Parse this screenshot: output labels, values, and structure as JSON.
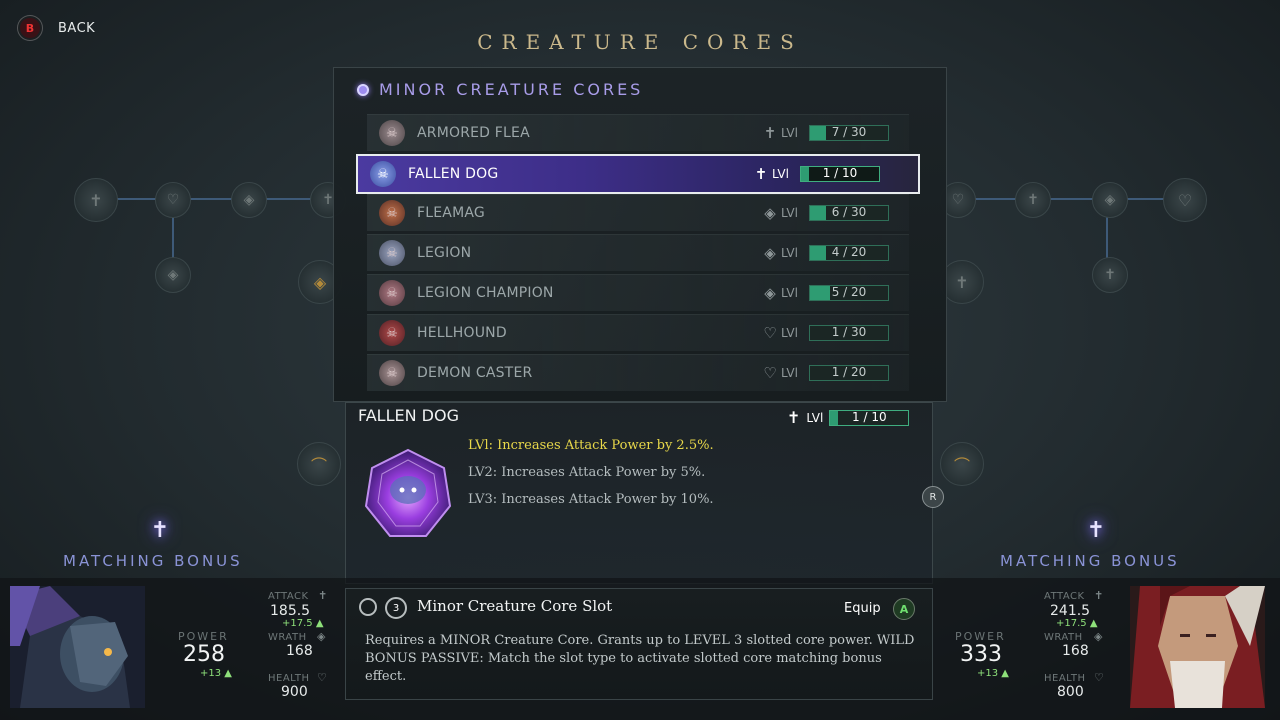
{
  "header": {
    "back_button_glyph": "B",
    "back_label": "BACK",
    "title": "CREATURE CORES"
  },
  "category": {
    "label": "MINOR CREATURE CORES"
  },
  "cores": [
    {
      "name": "ARMORED FLEA",
      "type_icon": "attack-icon",
      "lv_label": "LVl",
      "progress": "7 / 30",
      "fill": 0.2,
      "selected": false
    },
    {
      "name": "FALLEN DOG",
      "type_icon": "attack-icon",
      "lv_label": "LVl",
      "progress": "1 / 10",
      "fill": 0.1,
      "selected": true
    },
    {
      "name": "FLEAMAG",
      "type_icon": "wrath-icon",
      "lv_label": "LVl",
      "progress": "6 / 30",
      "fill": 0.2,
      "selected": false
    },
    {
      "name": "LEGION",
      "type_icon": "wrath-icon",
      "lv_label": "LVl",
      "progress": "4 / 20",
      "fill": 0.2,
      "selected": false
    },
    {
      "name": "LEGION CHAMPION",
      "type_icon": "wrath-icon",
      "lv_label": "LVl",
      "progress": "5 / 20",
      "fill": 0.25,
      "selected": false
    },
    {
      "name": "HELLHOUND",
      "type_icon": "health-icon",
      "lv_label": "LVl",
      "progress": "1 / 30",
      "fill": 0.0,
      "selected": false
    },
    {
      "name": "DEMON CASTER",
      "type_icon": "health-icon",
      "lv_label": "LVl",
      "progress": "1 / 20",
      "fill": 0.0,
      "selected": false
    }
  ],
  "detail": {
    "name": "FALLEN DOG",
    "lv_label": "LVl",
    "progress": "1 / 10",
    "fill": 0.1,
    "levels": [
      "LVl:  Increases Attack Power by 2.5%.",
      "LV2:  Increases Attack Power by 5%.",
      "LV3:  Increases Attack Power by 10%."
    ],
    "r_button": "R"
  },
  "slot": {
    "number": "3",
    "title": "Minor Creature Core Slot",
    "equip_label": "Equip",
    "equip_button": "A",
    "description": "Requires a MINOR Creature Core. Grants up to LEVEL 3 slotted core power. WILD BONUS PASSIVE: Match the slot type to activate slotted core matching bonus effect."
  },
  "left_character": {
    "matching_bonus": "MATCHING BONUS",
    "power_label": "POWER",
    "power": "258",
    "power_delta": "+13 ▲",
    "attack_label": "ATTACK",
    "attack": "185.5",
    "attack_delta": "+17.5 ▲",
    "wrath_label": "WRATH",
    "wrath": "168",
    "health_label": "HEALTH",
    "health": "900"
  },
  "right_character": {
    "matching_bonus": "MATCHING BONUS",
    "power_label": "POWER",
    "power": "333",
    "power_delta": "+13 ▲",
    "attack_label": "ATTACK",
    "attack": "241.5",
    "attack_delta": "+17.5 ▲",
    "wrath_label": "WRATH",
    "wrath": "168",
    "health_label": "HEALTH",
    "health": "800"
  },
  "colors": {
    "accent_purple": "#4b3aa0",
    "progress_green": "#2e9c72",
    "title_gold": "#cbb98c",
    "active_level_yellow": "#e8d84a"
  }
}
